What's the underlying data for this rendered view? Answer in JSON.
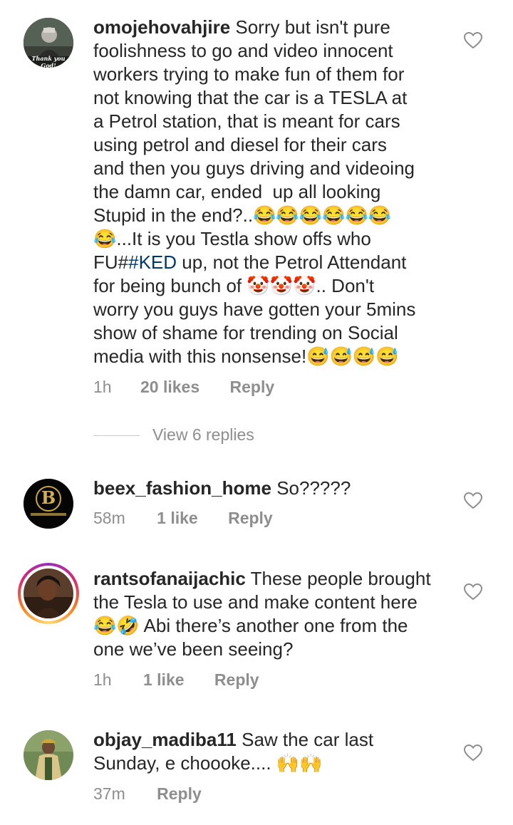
{
  "comments": [
    {
      "username": "omojehovahjire",
      "text_a": " Sorry but isn't pure\nfoolishness to go and video innocent\nworkers trying to make fun of them for\nnot knowing that the car is a TESLA at\na Petrol station, that is meant for cars\nusing petrol and diesel for their cars\nand then you guys driving and videoing\nthe damn car, ended  up all looking\nStupid in the end?..😂😂😂😂😂😂\n😂...It is you Testla show offs who\nFU#",
      "hashtag": "#KED",
      "text_b": " up, not the Petrol Attendant\nfor being bunch of 🤡🤡🤡.. Don't\nworry you guys have gotten your 5mins\nshow of shame for trending on Social\nmedia with this nonsense!😅😅😅😅",
      "time": "1h",
      "likes": "20 likes",
      "reply": "Reply",
      "avatar_caption": "Thank you God!",
      "avatar_icon": "person-photo-icon"
    },
    {
      "username": "beex_fashion_home",
      "text": " So?????",
      "time": "58m",
      "likes": "1 like",
      "reply": "Reply",
      "avatar_letter": "B",
      "avatar_icon": "brand-logo-icon"
    },
    {
      "username": "rantsofanaijachic",
      "text": " These people brought\nthe Tesla to use and make content here\n😂🤣 Abi there’s another one from the\none we’ve been seeing?",
      "time": "1h",
      "likes": "1 like",
      "reply": "Reply",
      "avatar_icon": "person-photo-icon"
    },
    {
      "username": "objay_madiba11",
      "text": " Saw the car last\nSunday, e choooke.... 🙌🙌",
      "time": "37m",
      "reply": "Reply",
      "avatar_icon": "person-photo-icon"
    }
  ],
  "view_replies": "View 6 replies",
  "colors": {
    "text": "#262626",
    "meta": "#8e8e8e",
    "hashtag": "#00376b",
    "story_ring": [
      "#feda75",
      "#fa7e1e",
      "#d62976",
      "#962fbf"
    ]
  }
}
